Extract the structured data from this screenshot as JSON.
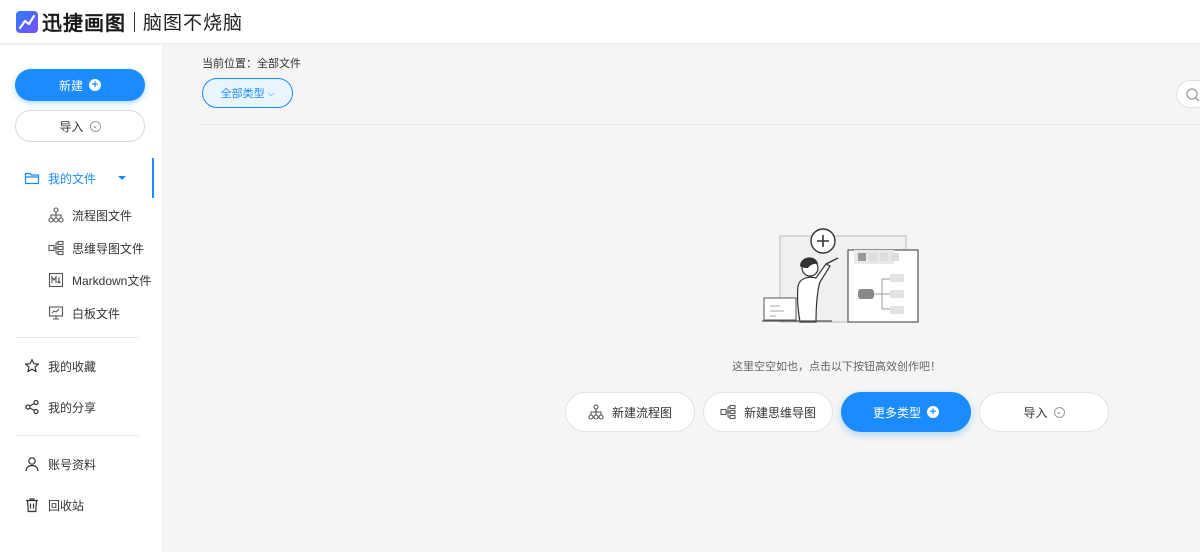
{
  "header": {
    "brand": "迅捷画图",
    "slogan": "脑图不烧脑"
  },
  "sidebar": {
    "new_label": "新建",
    "import_label": "导入",
    "my_files": "我的文件",
    "sub_items": [
      {
        "label": "流程图文件",
        "icon": "flowchart-icon"
      },
      {
        "label": "思维导图文件",
        "icon": "mindmap-icon"
      },
      {
        "label": "Markdown文件",
        "icon": "markdown-icon"
      },
      {
        "label": "白板文件",
        "icon": "whiteboard-icon"
      }
    ],
    "favorites": "我的收藏",
    "shares": "我的分享",
    "account": "账号资料",
    "trash": "回收站"
  },
  "main": {
    "breadcrumb": "当前位置：全部文件",
    "type_filter": "全部类型",
    "empty_message": "这里空空如也，点击以下按钮高效创作吧！",
    "actions": {
      "new_flowchart": "新建流程图",
      "new_mindmap": "新建思维导图",
      "more_types": "更多类型",
      "import": "导入"
    }
  },
  "colors": {
    "accent": "#1a8cff",
    "background": "#f5f5f5"
  }
}
